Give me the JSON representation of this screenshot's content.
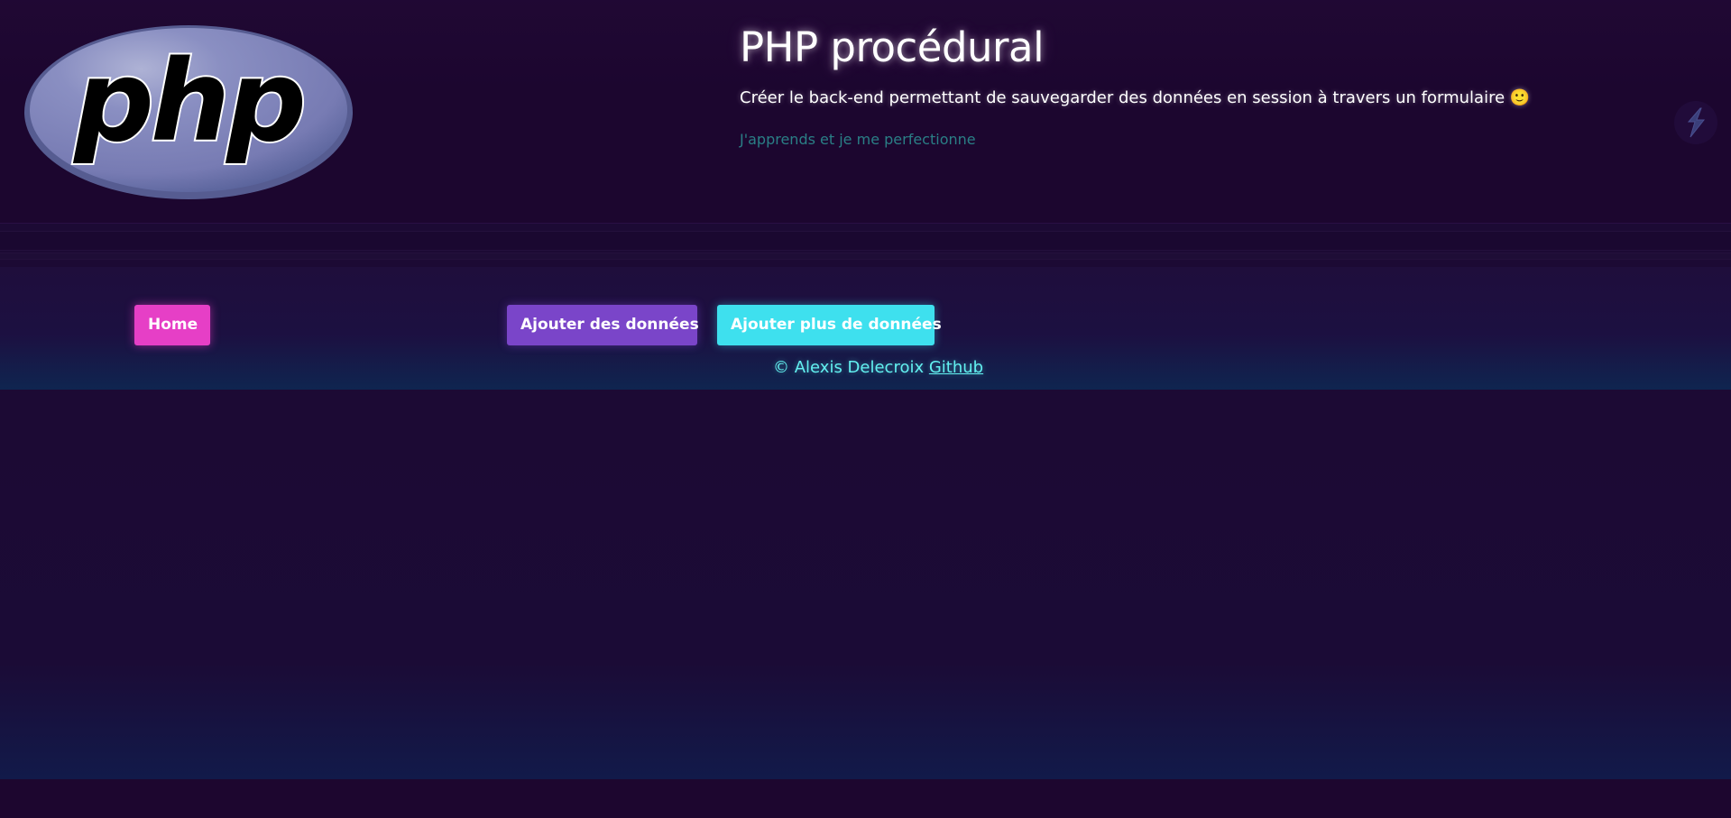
{
  "header": {
    "logo_text": "php",
    "title": "PHP procédural",
    "subtitle": "Créer le back-end permettant de sauvegarder des données en session à travers un formulaire 🙂",
    "tagline": "J'apprends et je me perfectionne",
    "theme_toggle_icon": "lightning-bolt-icon"
  },
  "nav": {
    "buttons": [
      {
        "label": "Home",
        "color": "#e63fc6"
      },
      {
        "label": "Ajouter des données",
        "color": "#7a45c9"
      },
      {
        "label": "Ajouter plus de données",
        "color": "#3ee0ee"
      }
    ]
  },
  "footer": {
    "credit": "© Alexis Delecroix",
    "link_label": "Github"
  },
  "colors": {
    "background": "#1c0a34",
    "accent_cyan": "#62f0f0",
    "tagline": "#2a7f86"
  }
}
